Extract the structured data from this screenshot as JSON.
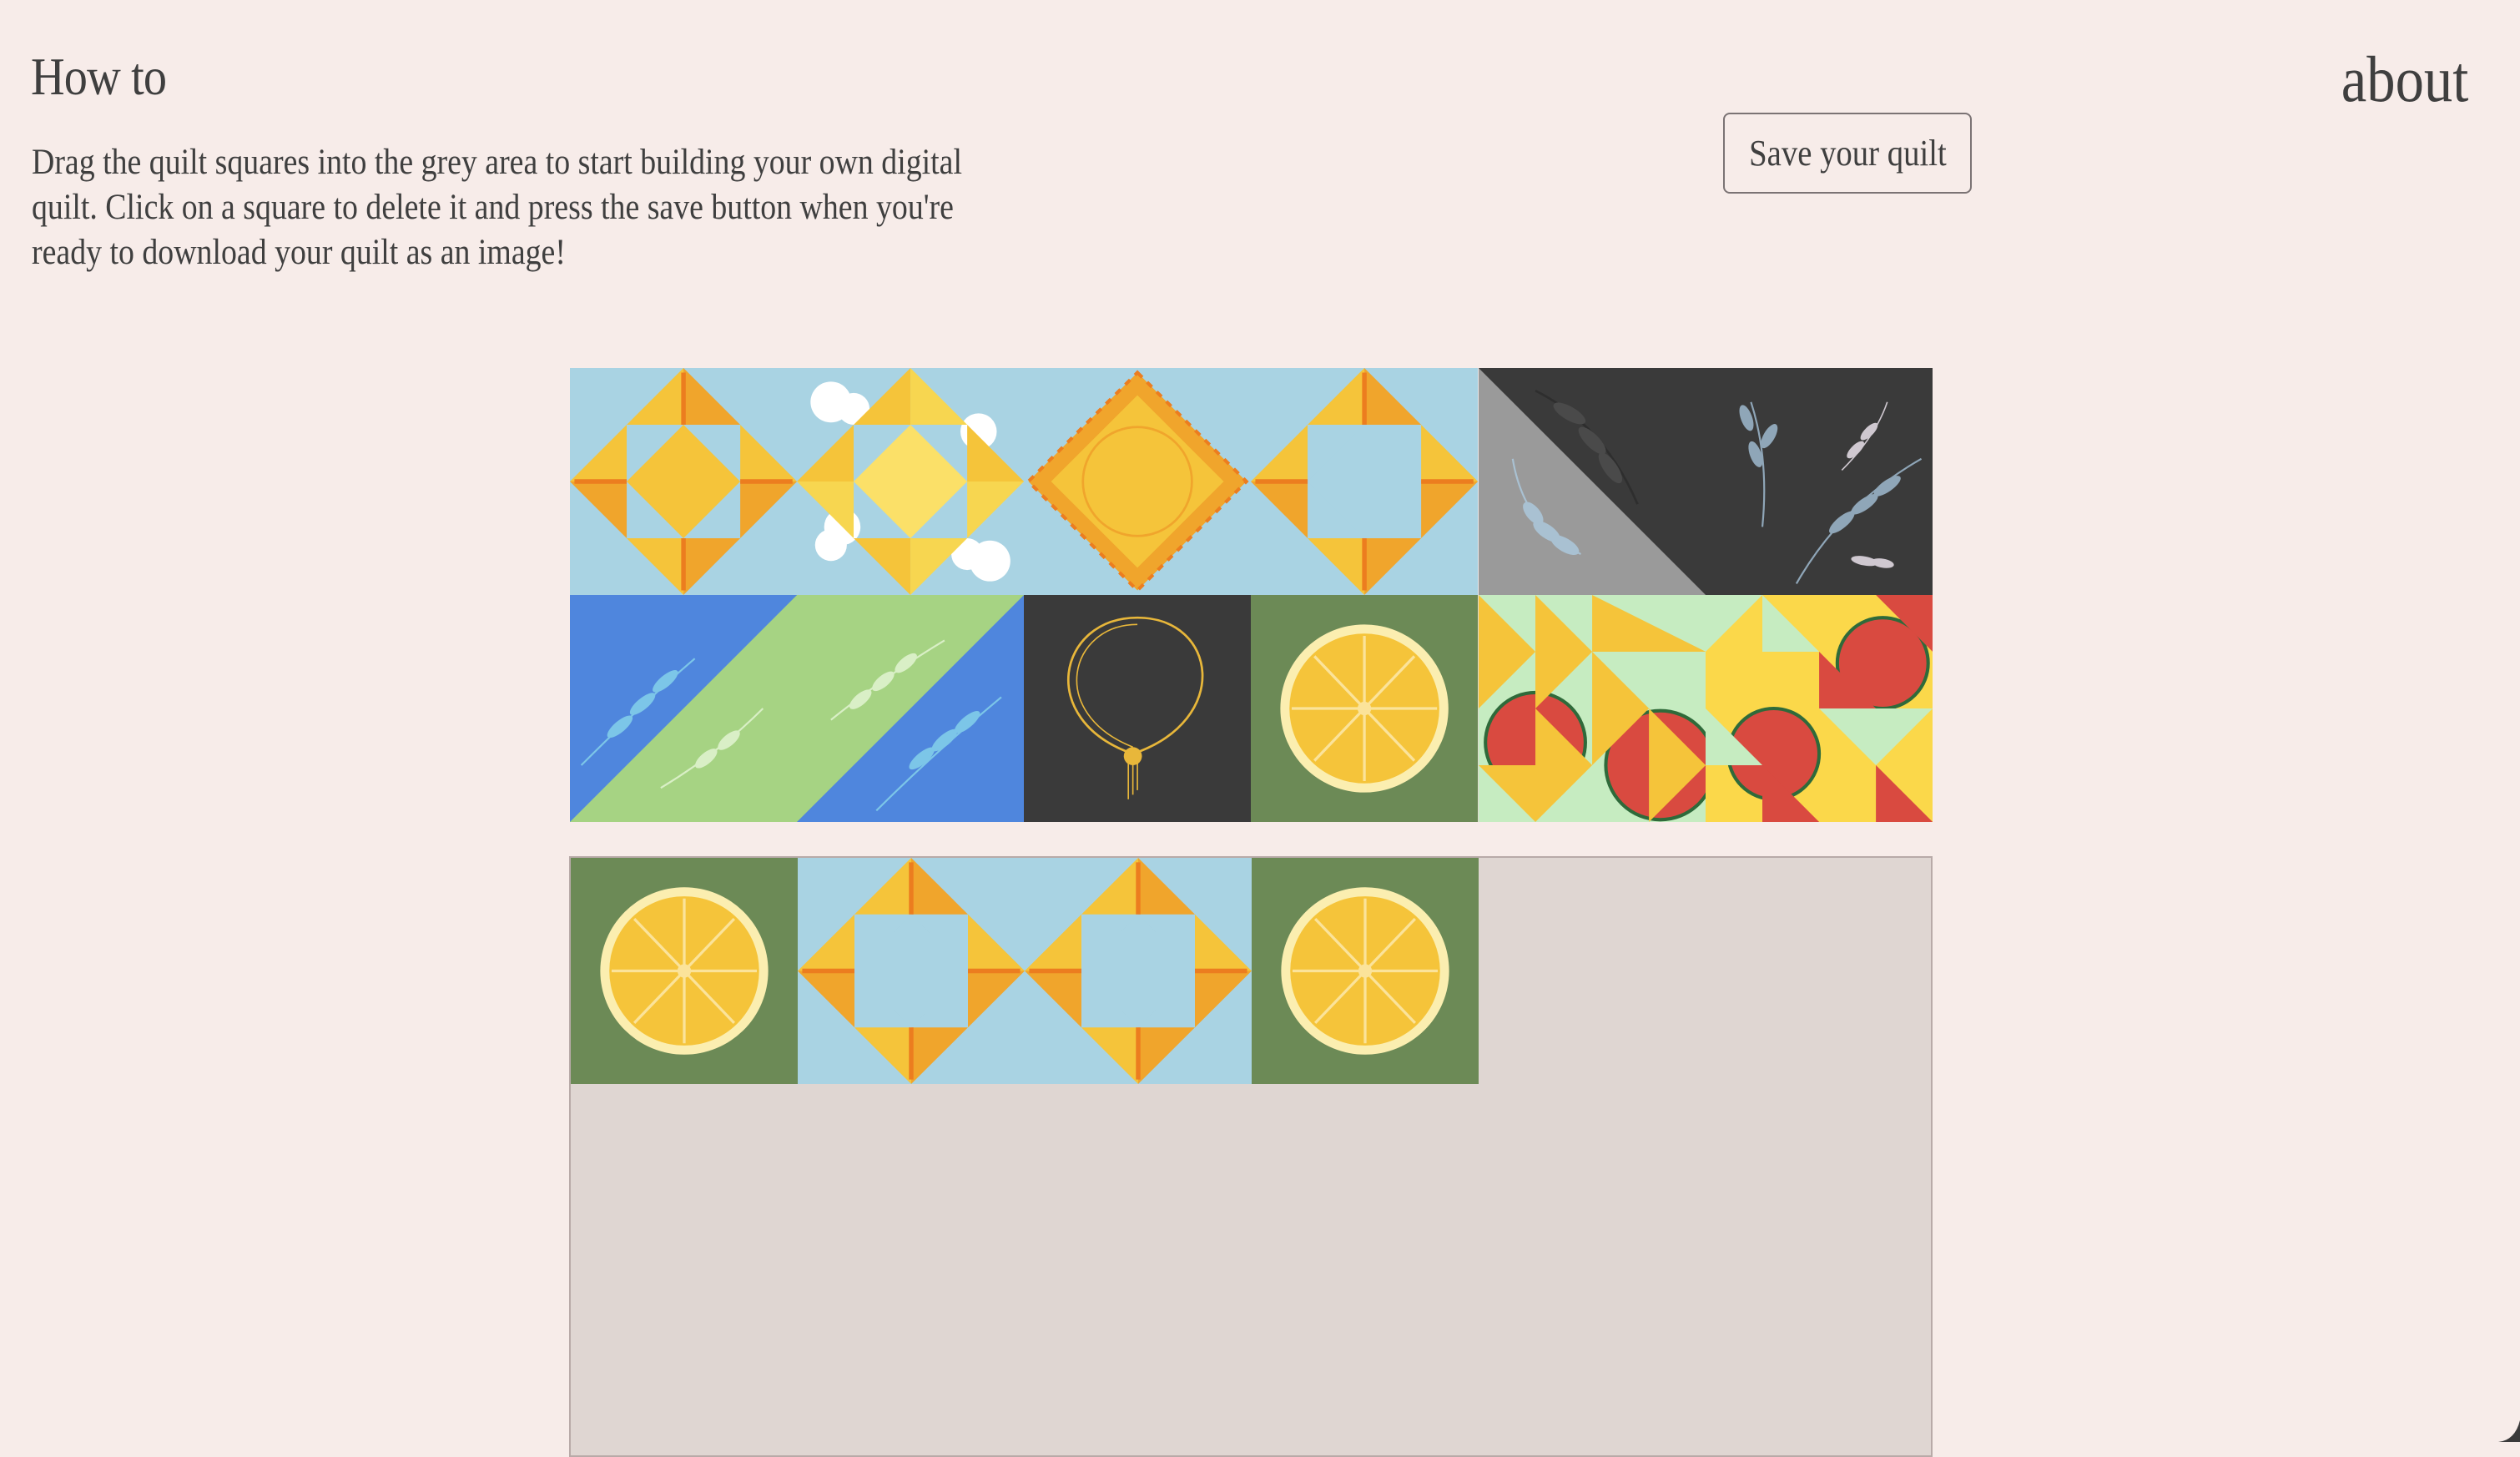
{
  "header": {
    "title": "How to",
    "about": "about",
    "instructions": "Drag the quilt squares into the grey area to start building your own digital quilt. Click on a square to delete it and press the save button when you're ready to download your quilt as an image!",
    "save_label": "Save your quilt"
  },
  "palette": {
    "tiles": [
      "sun-star-tile",
      "cloud-star-tile",
      "sun-diamond-tile",
      "sun-star-tile",
      "grey-leaf-tile",
      "dark-leaves-tile",
      "blue-green-leaf-tile",
      "green-blue-leaf-tile",
      "necklace-tile",
      "lemon-tile",
      "watermelon-triangles-tile",
      "watermelon-pinwheel-tile"
    ]
  },
  "board": {
    "tiles": [
      "lemon-tile",
      "sun-star-tile",
      "sun-star-tile",
      "lemon-tile"
    ]
  },
  "colors": {
    "background": "#f7ece9",
    "board": "#dfd6d2",
    "sky": "#a9d3e3",
    "sun": "#f5c43a",
    "orange": "#ec8a22",
    "olive": "#6c8a56",
    "charcoal": "#3a3a3a",
    "blue": "#4f86dd",
    "green": "#a6d383",
    "watermelon": "#d94a40"
  }
}
